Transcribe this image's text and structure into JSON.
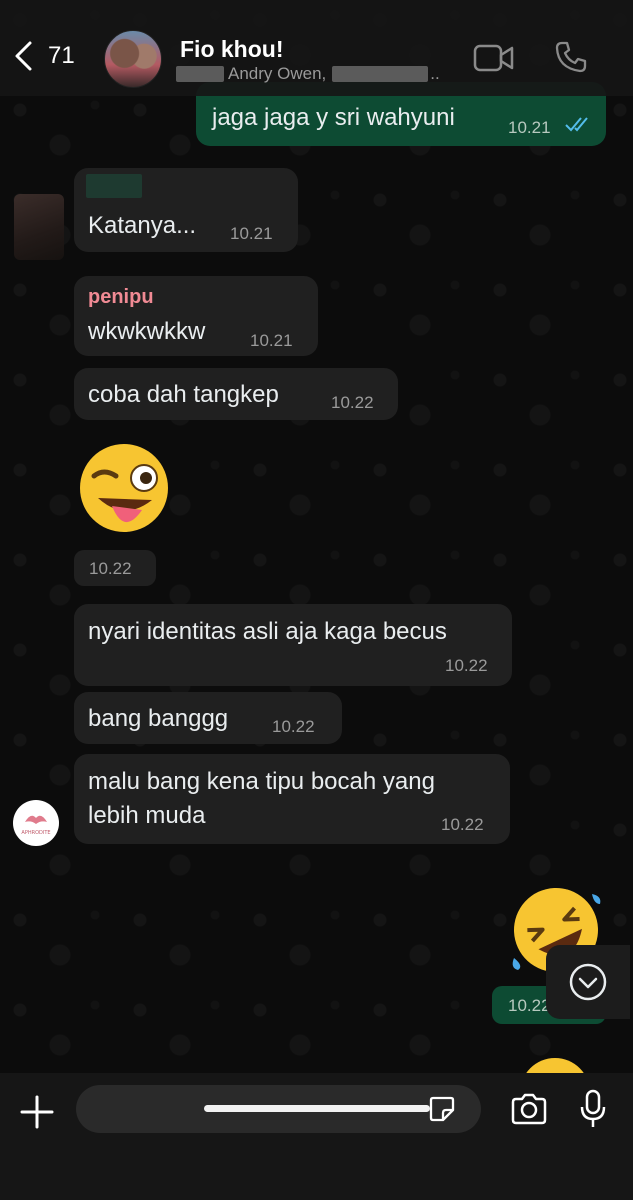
{
  "header": {
    "back_count": "71",
    "title": "Fio khou!",
    "members": "Andry Owen,",
    "members_ellipsis": ".."
  },
  "messages": [
    {
      "id": "m1",
      "direction": "out",
      "text": "jaga jaga y sri wahyuni",
      "time": "10.21",
      "status": "read"
    },
    {
      "id": "m2",
      "direction": "in",
      "text": "Katanya...",
      "time": "10.21"
    },
    {
      "id": "m3",
      "direction": "in",
      "sender": "penipu",
      "text": "wkwkwkkw",
      "time": "10.21"
    },
    {
      "id": "m4",
      "direction": "in",
      "text": "coba dah tangkep",
      "time": "10.22"
    },
    {
      "id": "m5",
      "direction": "in",
      "emoji": "😜",
      "time": "10.22"
    },
    {
      "id": "m6",
      "direction": "in",
      "text": "nyari identitas asli aja kaga becus",
      "time": "10.22"
    },
    {
      "id": "m7",
      "direction": "in",
      "text": "bang banggg",
      "time": "10.22"
    },
    {
      "id": "m8",
      "direction": "in",
      "text_line1": "malu bang kena tipu bocah yang",
      "text_line2": "lebih muda",
      "time": "10.22"
    },
    {
      "id": "m9",
      "direction": "out",
      "emoji": "🤣",
      "time": "10.22"
    }
  ],
  "logo_text": "APHRODITE",
  "composer": {
    "placeholder": ""
  },
  "colors": {
    "outgoing_bubble": "#0d4b33",
    "incoming_bubble": "#202020",
    "sender_name": "#f08a94",
    "read_ticks": "#53bdeb"
  },
  "icons": [
    "back-chevron-icon",
    "video-call-icon",
    "phone-icon",
    "plus-icon",
    "sticker-icon",
    "camera-icon",
    "mic-icon",
    "chevron-down-icon"
  ]
}
